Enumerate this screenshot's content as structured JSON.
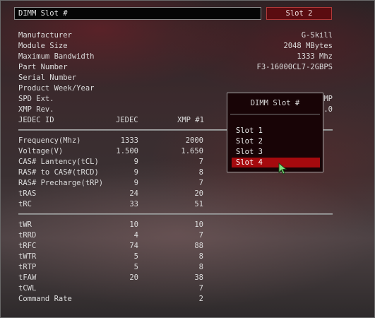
{
  "header": {
    "field_label": "DIMM Slot #",
    "slot_button_label": "Slot 2"
  },
  "info": [
    {
      "label": "Manufacturer",
      "value": "G-Skill"
    },
    {
      "label": "Module Size",
      "value": "2048 MBytes"
    },
    {
      "label": "Maximum Bandwidth",
      "value": "1333 Mhz"
    },
    {
      "label": "Part Number",
      "value": "F3-16000CL7-2GBPS"
    },
    {
      "label": "Serial Number",
      "value": ""
    },
    {
      "label": "Product Week/Year",
      "value": ""
    },
    {
      "label": "SPD Ext.",
      "value": "MP"
    },
    {
      "label": "XMP Rev.",
      "value": ".0"
    }
  ],
  "table_header": {
    "label": "JEDEC ID",
    "col1": "JEDEC",
    "col2": "XMP #1"
  },
  "timings_a": [
    {
      "label": "Frequency(Mhz)",
      "jedec": "1333",
      "xmp": "2000"
    },
    {
      "label": "Voltage(V)",
      "jedec": "1.500",
      "xmp": "1.650"
    },
    {
      "label": "CAS# Lantency(tCL)",
      "jedec": "9",
      "xmp": "7"
    },
    {
      "label": "RAS# to CAS#(tRCD)",
      "jedec": "9",
      "xmp": "8"
    },
    {
      "label": "RAS# Precharge(tRP)",
      "jedec": "9",
      "xmp": "7"
    },
    {
      "label": "tRAS",
      "jedec": "24",
      "xmp": "20"
    },
    {
      "label": "tRC",
      "jedec": "33",
      "xmp": "51"
    }
  ],
  "timings_b": [
    {
      "label": "tWR",
      "jedec": "10",
      "xmp": "10"
    },
    {
      "label": "tRRD",
      "jedec": "4",
      "xmp": "7"
    },
    {
      "label": "tRFC",
      "jedec": "74",
      "xmp": "88"
    },
    {
      "label": "tWTR",
      "jedec": "5",
      "xmp": "8"
    },
    {
      "label": "tRTP",
      "jedec": "5",
      "xmp": "8"
    },
    {
      "label": "tFAW",
      "jedec": "20",
      "xmp": "38"
    },
    {
      "label": "tCWL",
      "jedec": "",
      "xmp": "7"
    },
    {
      "label": "Command Rate",
      "jedec": "",
      "xmp": "2"
    }
  ],
  "popup": {
    "title": "DIMM Slot #",
    "options": [
      "Slot 1",
      "Slot 2",
      "Slot 3",
      "Slot 4"
    ],
    "selected_index": 3
  },
  "colors": {
    "accent": "#a50a0e",
    "button_bg": "#5a0c10"
  },
  "icons": {
    "cursor": "mouse-pointer-icon"
  }
}
